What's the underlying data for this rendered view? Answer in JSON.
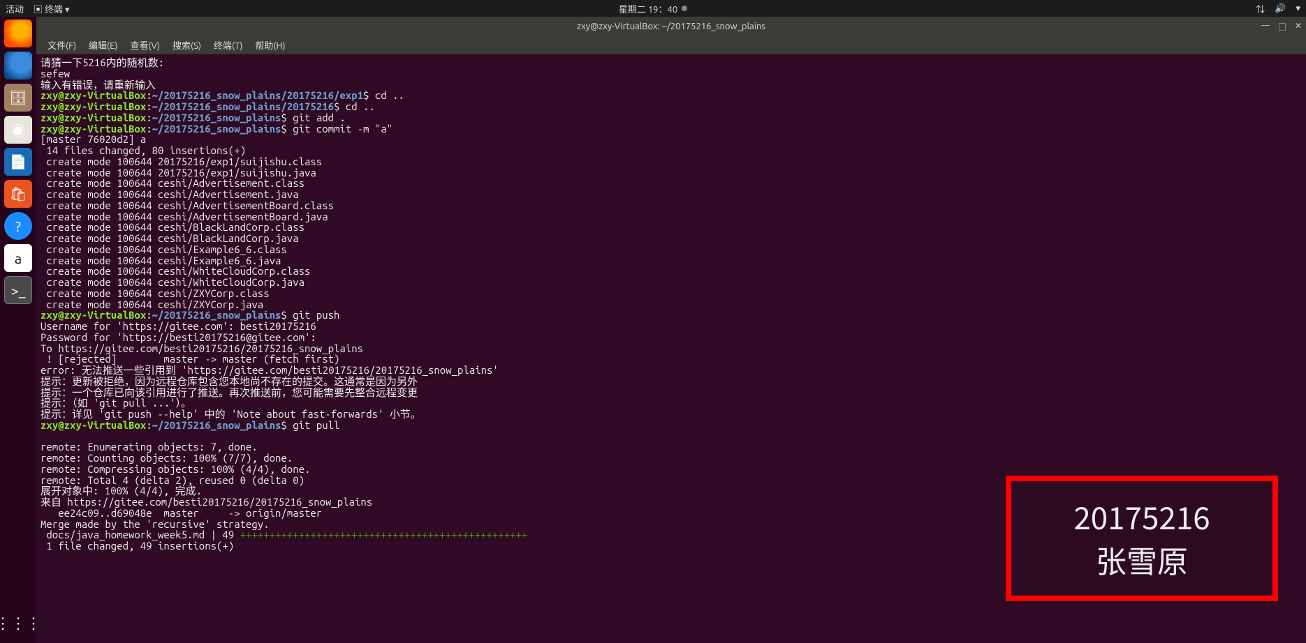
{
  "topbar": {
    "activities": "活动",
    "app_indicator": "终端",
    "datetime": "星期二 19：40",
    "tray": {
      "network": "⇅",
      "volume": "🔊",
      "power": "▾"
    }
  },
  "launcher": {
    "firefox": "Firefox",
    "thunderbird": "Thunderbird",
    "files": "文件",
    "rhythmbox": "Rhythmbox",
    "writer": "LibreOffice Writer",
    "software": "Ubuntu Software",
    "help": "?",
    "amazon": "a",
    "terminal": ">_",
    "apps": "⋮⋮⋮"
  },
  "window": {
    "title": "zxy@zxy-VirtualBox: ~/20175216_snow_plains",
    "controls": {
      "min": "—",
      "max": "□",
      "close": "✕"
    }
  },
  "menubar": {
    "file": "文件(F)",
    "edit": "编辑(E)",
    "view": "查看(V)",
    "search": "搜索(S)",
    "terminal": "终端(T)",
    "help": "帮助(H)"
  },
  "prompt": {
    "user1": "zxy@zxy-VirtualBox",
    "sep": ":",
    "path_exp1": "~/20175216_snow_plains/20175216/exp1",
    "path_sub": "~/20175216_snow_plains/20175216",
    "path_root": "~/20175216_snow_plains",
    "dollar": "$",
    "cd_up": " cd ..",
    "git_add": " git add .",
    "git_commit": " git commit -m \"a\"",
    "git_push": " git push",
    "git_pull": " git pull"
  },
  "lines": {
    "l01": "请猜一下5216内的随机数:",
    "l02": "sefew",
    "l03": "输入有错误，请重新输入",
    "l04": "[master 76020d2] a",
    "l05": " 14 files changed, 80 insertions(+)",
    "l06": " create mode 100644 20175216/exp1/suijishu.class",
    "l07": " create mode 100644 20175216/exp1/suijishu.java",
    "l08": " create mode 100644 ceshi/Advertisement.class",
    "l09": " create mode 100644 ceshi/Advertisement.java",
    "l10": " create mode 100644 ceshi/AdvertisementBoard.class",
    "l11": " create mode 100644 ceshi/AdvertisementBoard.java",
    "l12": " create mode 100644 ceshi/BlackLandCorp.class",
    "l13": " create mode 100644 ceshi/BlackLandCorp.java",
    "l14": " create mode 100644 ceshi/Example6_6.class",
    "l15": " create mode 100644 ceshi/Example6_6.java",
    "l16": " create mode 100644 ceshi/WhiteCloudCorp.class",
    "l17": " create mode 100644 ceshi/WhiteCloudCorp.java",
    "l18": " create mode 100644 ceshi/ZXYCorp.class",
    "l19": " create mode 100644 ceshi/ZXYCorp.java",
    "l20": "Username for 'https://gitee.com': besti20175216",
    "l21": "Password for 'https://besti20175216@gitee.com':",
    "l22": "To https://gitee.com/besti20175216/20175216_snow_plains",
    "l23": " ! [rejected]        master -> master (fetch first)",
    "l24": "error: 无法推送一些引用到 'https://gitee.com/besti20175216/20175216_snow_plains'",
    "l25": "提示：更新被拒绝，因为远程仓库包含您本地尚不存在的提交。这通常是因为另外",
    "l26": "提示：一个仓库已向该引用进行了推送。再次推送前，您可能需要先整合远程变更",
    "l27": "提示：（如 'git pull ...'）。",
    "l28": "提示：详见 'git push --help' 中的 'Note about fast-forwards' 小节。",
    "l29": "remote: Enumerating objects: 7, done.",
    "l30": "remote: Counting objects: 100% (7/7), done.",
    "l31": "remote: Compressing objects: 100% (4/4), done.",
    "l32": "remote: Total 4 (delta 2), reused 0 (delta 0)",
    "l33": "展开对象中: 100% (4/4), 完成.",
    "l34": "来自 https://gitee.com/besti20175216/20175216_snow_plains",
    "l35": "   ee24c09..d69048e  master     -> origin/master",
    "l36": "Merge made by the 'recursive' strategy.",
    "l37_a": " docs/java_homework_week5.md | 49 ",
    "l37_b": "+++++++++++++++++++++++++++++++++++++++++++++++++",
    "l38": " 1 file changed, 49 insertions(+)"
  },
  "overlay": {
    "id": "20175216",
    "name": "张雪原"
  }
}
